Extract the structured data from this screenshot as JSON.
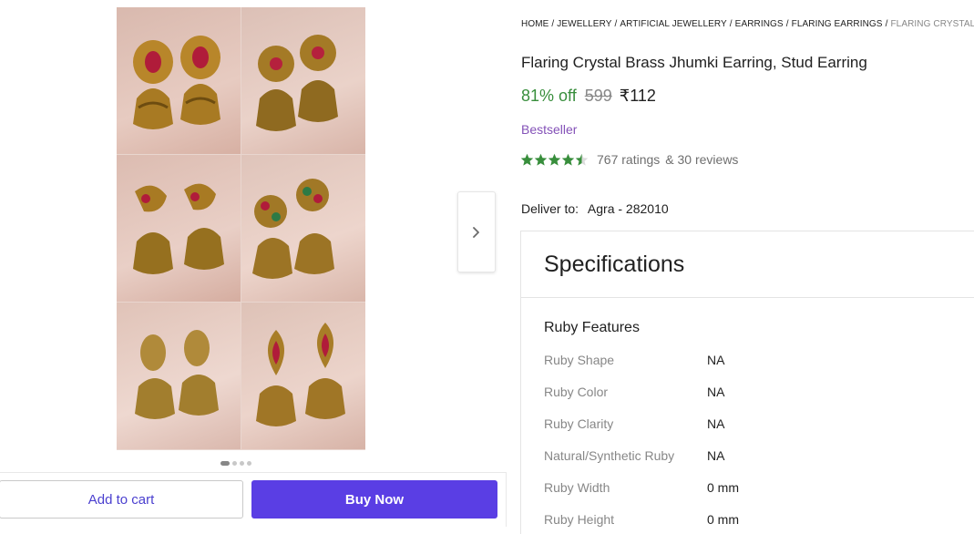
{
  "gallery": {
    "next_icon": "chevron-right-icon",
    "images": 6,
    "carousel_dots": 4,
    "active_dot": 1
  },
  "actions": {
    "add_to_cart": "Add to cart",
    "buy_now": "Buy Now"
  },
  "breadcrumb": [
    "HOME",
    "JEWELLERY",
    "ARTIFICIAL JEWELLERY",
    "EARRINGS",
    "FLARING EARRINGS",
    "FLARING CRYSTAL BR"
  ],
  "product": {
    "title": "Flaring Crystal Brass Jhumki Earring, Stud Earring",
    "discount": "81% off",
    "mrp": "599",
    "price": "₹112",
    "badge": "Bestseller",
    "rating_stars": 4.5,
    "ratings": "767 ratings",
    "reviews": "& 30 reviews"
  },
  "delivery": {
    "label": "Deliver to:",
    "location": "Agra - 282010"
  },
  "specifications": {
    "heading": "Specifications",
    "section": "Ruby Features",
    "rows": [
      {
        "key": "Ruby Shape",
        "value": "NA"
      },
      {
        "key": "Ruby Color",
        "value": "NA"
      },
      {
        "key": "Ruby Clarity",
        "value": "NA"
      },
      {
        "key": "Natural/Synthetic Ruby",
        "value": "NA"
      },
      {
        "key": "Ruby Width",
        "value": "0 mm"
      },
      {
        "key": "Ruby Height",
        "value": "0 mm"
      }
    ]
  },
  "colors": {
    "accent": "#5a3ee4",
    "discount_green": "#388e3c",
    "star_green": "#388e3c",
    "bestseller_purple": "#8452b8"
  }
}
